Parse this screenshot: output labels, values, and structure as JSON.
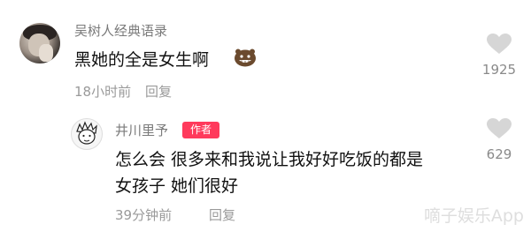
{
  "comment_top": {
    "username": "吴树人经典语录",
    "text": "黑她的全是女生啊",
    "emoji_icon": "grinning-face-icon",
    "time": "18小时前",
    "reply_label": "回复",
    "like_count": "1925"
  },
  "comment_reply": {
    "username": "井川里予",
    "badge": "作者",
    "text_line1": "怎么会 很多来和我说让我好好吃饭的都是",
    "text_line2": "女孩子 她们很好",
    "time": "39分钟前",
    "reply_label": "回复",
    "like_count": "629"
  },
  "watermark": {
    "text": "嘀子娱乐App"
  },
  "colors": {
    "badge": "#ff3a5c",
    "meta": "#9a9a9a",
    "heart": "#d6d6d6"
  }
}
